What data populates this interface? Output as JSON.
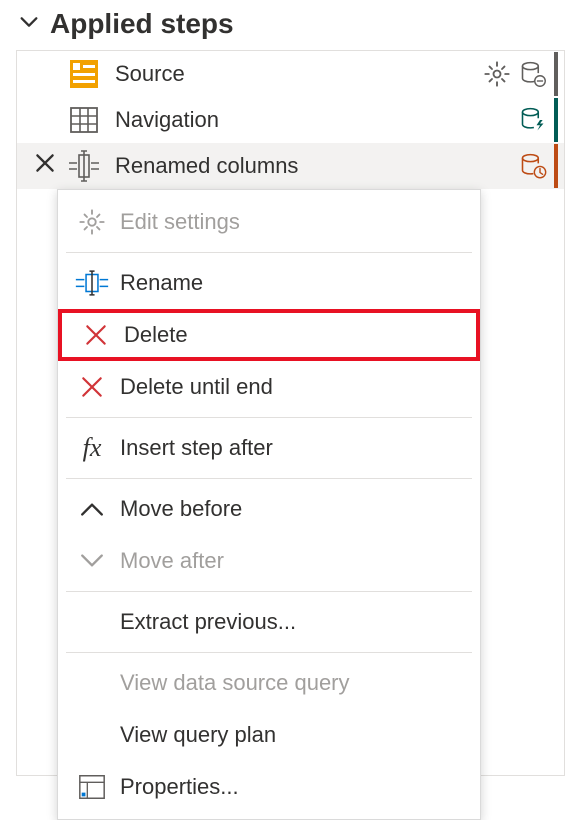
{
  "section": {
    "title": "Applied steps"
  },
  "steps": [
    {
      "label": "Source"
    },
    {
      "label": "Navigation"
    },
    {
      "label": "Renamed columns"
    }
  ],
  "context_menu": {
    "items": [
      {
        "label": "Edit settings",
        "enabled": false
      },
      {
        "label": "Rename",
        "enabled": true
      },
      {
        "label": "Delete",
        "enabled": true,
        "highlighted": true
      },
      {
        "label": "Delete until end",
        "enabled": true
      },
      {
        "label": "Insert step after",
        "enabled": true
      },
      {
        "label": "Move before",
        "enabled": true
      },
      {
        "label": "Move after",
        "enabled": false
      },
      {
        "label": "Extract previous...",
        "enabled": true
      },
      {
        "label": "View data source query",
        "enabled": false
      },
      {
        "label": "View query plan",
        "enabled": true
      },
      {
        "label": "Properties...",
        "enabled": true
      }
    ]
  }
}
